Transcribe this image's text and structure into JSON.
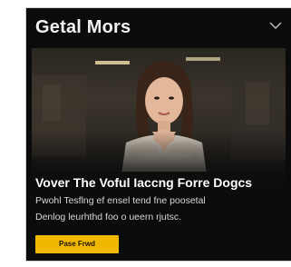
{
  "card": {
    "title": "Getal Mors",
    "headline": "Vover The Voful Iaccng Forre Dogcs",
    "description_lines": [
      "Pwohl Tesflng ef ensel tend fne poosetal",
      "Denlog leurhthd foo o ueern rjutsc."
    ],
    "cta_label": "Pase Frwd"
  },
  "icons": {
    "collapse": "chevron-down-icon"
  },
  "colors": {
    "card_background": "#0b0b0b",
    "title_text": "#f2f2f2",
    "cta_background": "#f0b800",
    "cta_text": "#1a1300"
  }
}
